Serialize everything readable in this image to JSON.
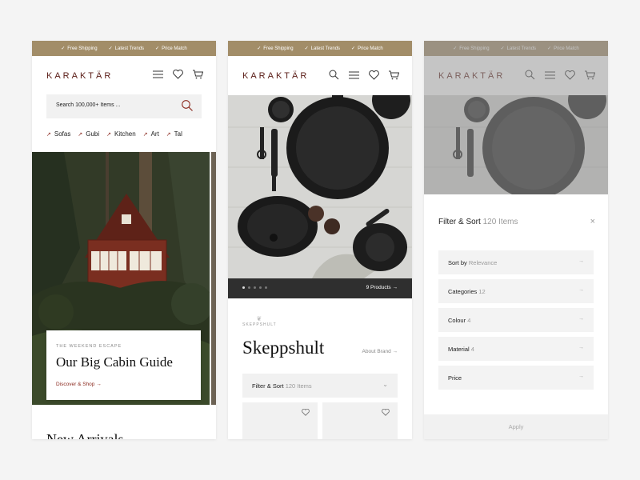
{
  "colors": {
    "accent": "#a28d68",
    "brand": "#5a1c16",
    "link": "#8b2a1f"
  },
  "topbar": {
    "items": [
      "Free Shipping",
      "Latest Trends",
      "Price Match"
    ]
  },
  "brand": {
    "logo": "KARAKTÄR"
  },
  "home": {
    "search_placeholder": "Search 100,000+ Items ...",
    "categories": [
      "Sofas",
      "Gubi",
      "Kitchen",
      "Art",
      "Tal"
    ],
    "hero": {
      "eyebrow": "THE WEEKEND ESCAPE",
      "title": "Our Big Cabin Guide",
      "cta": "Discover & Shop →"
    },
    "section_title": "New Arrivals"
  },
  "brand_page": {
    "products_count": "9 Products →",
    "brand_logo_text": "SKEPPSHULT",
    "brand_name": "Skeppshult",
    "about": "About Brand →",
    "filter_label": "Filter & Sort",
    "filter_count": "120 Items",
    "filter_chevron": "⌄"
  },
  "filter_sheet": {
    "title": "Filter & Sort",
    "count": "120 Items",
    "close": "×",
    "options": [
      {
        "label": "Sort by",
        "value": "Relevance"
      },
      {
        "label": "Categories",
        "value": "12"
      },
      {
        "label": "Colour",
        "value": "4"
      },
      {
        "label": "Material",
        "value": "4"
      },
      {
        "label": "Price",
        "value": ""
      }
    ],
    "apply": "Apply"
  }
}
